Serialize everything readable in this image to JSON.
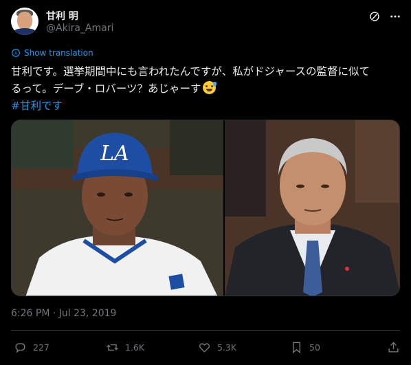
{
  "author": {
    "name": "甘利 明",
    "handle": "@Akira_Amari"
  },
  "header_icons": [
    "grok-icon",
    "more-icon"
  ],
  "translate_label": "Show translation",
  "tweet": {
    "line1": "甘利です。選挙期間中にも言われたんですが、私がドジャースの監督に似て",
    "line2": "るって。デーブ・ロバーツ？あじゃーす",
    "emoji": "sweat-smile-emoji",
    "hashtag": "#甘利です"
  },
  "media": {
    "left_image": "Man in a blue LA Dodgers cap and white jersey",
    "right_image": "Older man with grey hair in dark suit and blue tie"
  },
  "timestamp": "6:26 PM · Jul 23, 2019",
  "actions": {
    "replies": "227",
    "reposts": "1.6K",
    "likes": "5.3K",
    "bookmarks": "50"
  },
  "colors": {
    "background": "#000000",
    "text": "#e7e9ea",
    "muted": "#71767b",
    "accent": "#1d9bf0"
  }
}
